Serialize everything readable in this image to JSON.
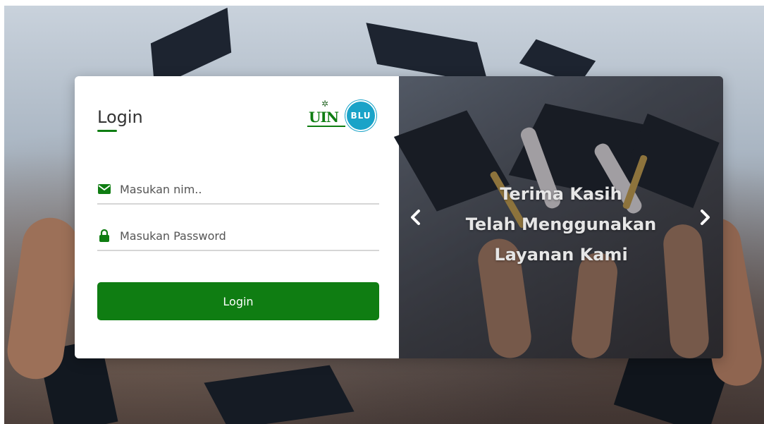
{
  "login": {
    "title": "Login",
    "nim_placeholder": "Masukan nim..",
    "password_placeholder": "Masukan Password",
    "button_label": "Login"
  },
  "logo": {
    "uin_text": "UIN",
    "blu_text": "BLU"
  },
  "slider": {
    "lines": [
      "Terima Kasih",
      "Telah Menggunakan",
      "Layanan Kami"
    ]
  },
  "colors": {
    "primary_green": "#0f7d12",
    "blu_blue": "#1aa3c8"
  },
  "icons": {
    "nim": "envelope-icon",
    "password": "lock-icon",
    "prev": "chevron-left-icon",
    "next": "chevron-right-icon"
  }
}
